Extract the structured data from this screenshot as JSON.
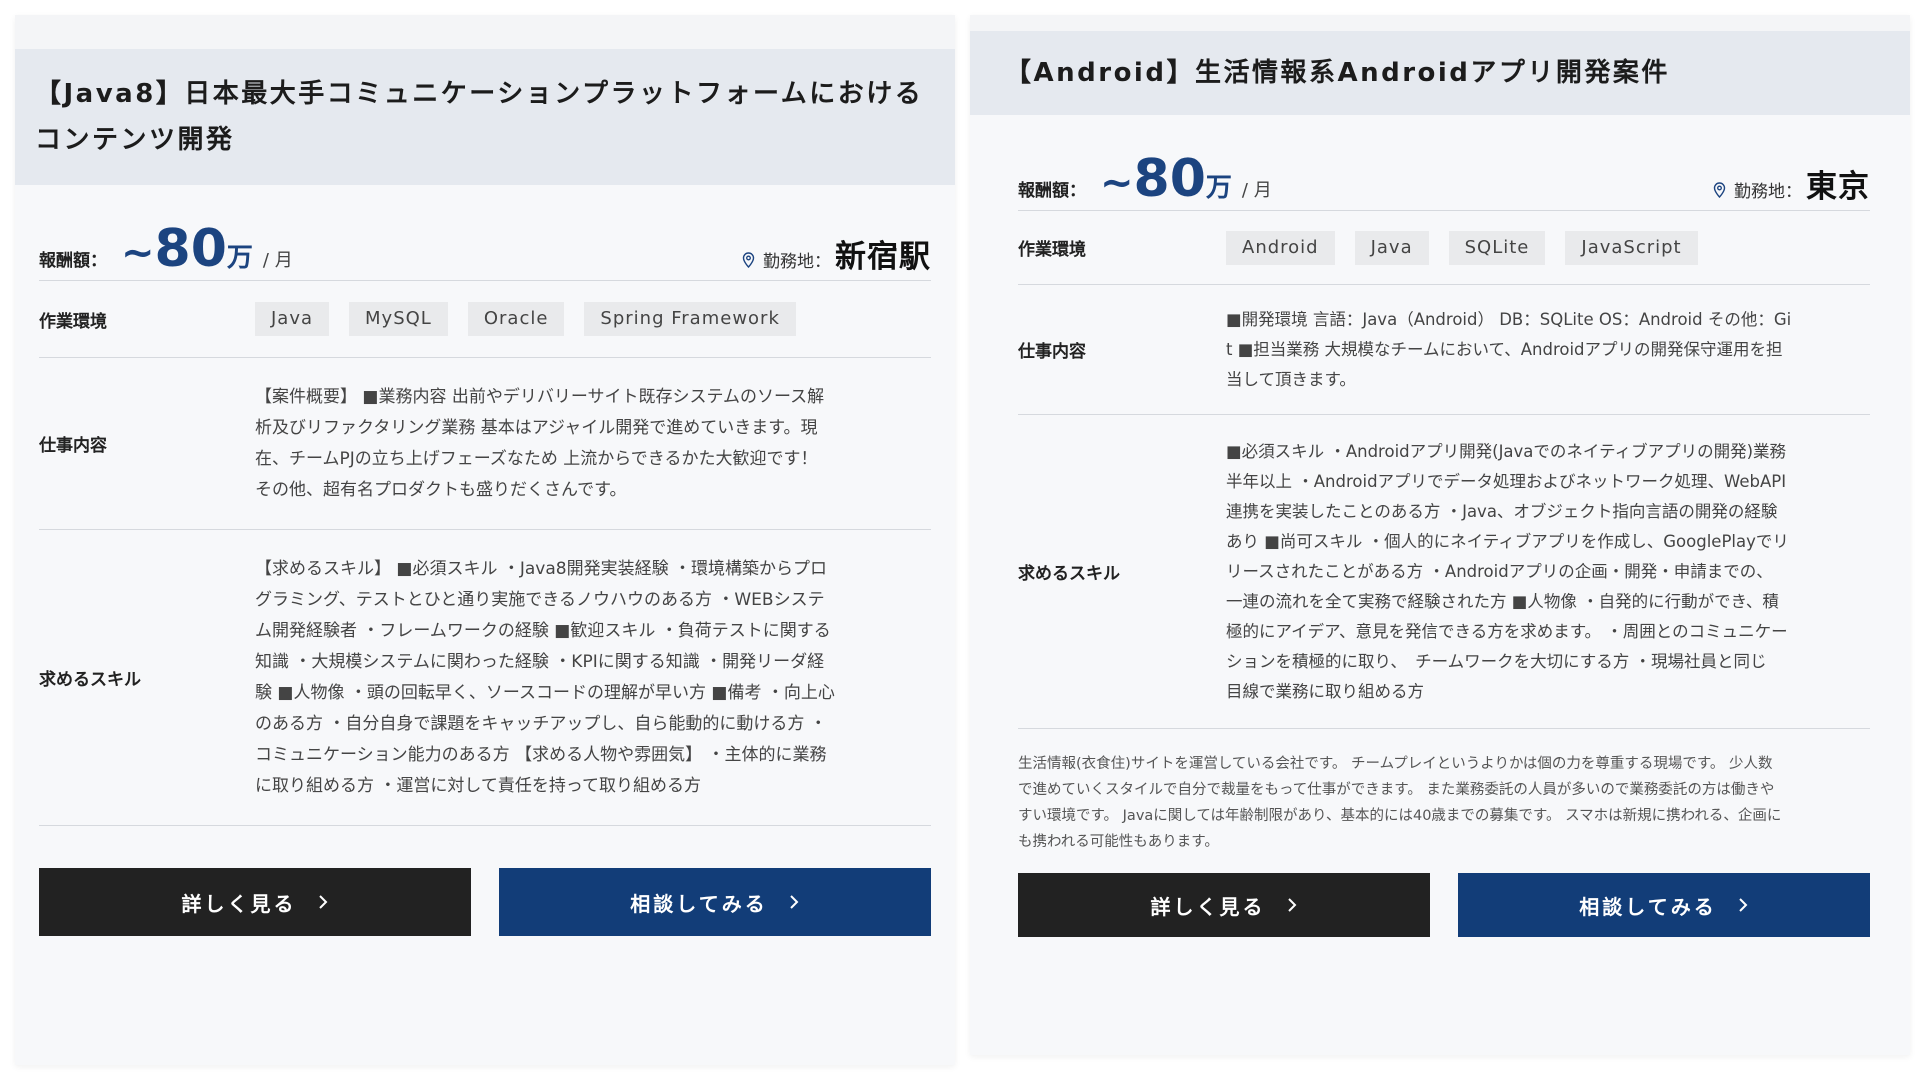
{
  "cards": [
    {
      "title_line1": "【Java8】日本最大手コミュニケーションプラットフォームにおける",
      "title_line2": "コンテンツ開発",
      "salary_label": "報酬額：",
      "salary_tilde": "~",
      "salary_value": "80",
      "salary_unit": "万",
      "salary_per": "/ 月",
      "location_label": "勤務地：",
      "location_value": "新宿駅",
      "env_label": "作業環境",
      "tags": [
        "Java",
        "MySQL",
        "Oracle",
        "Spring Framework"
      ],
      "job_label": "仕事内容",
      "job_lines": [
        "【案件概要】 ■業務内容 出前やデリバリーサイト既存システムのソース解",
        "析及びリファクタリング業務 基本はアジャイル開発で進めていきます。現",
        "在、チームPJの立ち上げフェーズなため 上流からできるかた大歓迎です！",
        "その他、超有名プロダクトも盛りだくさんです。"
      ],
      "skill_label": "求めるスキル",
      "skill_lines": [
        "【求めるスキル】 ■必須スキル ・Java8開発実装経験 ・環境構築からプロ",
        "グラミング、テストとひと通り実施できるノウハウのある方 ・WEBシステ",
        "ム開発経験者 ・フレームワークの経験 ■歓迎スキル ・負荷テストに関する",
        "知識 ・大規模システムに関わった経験 ・KPIに関する知識 ・開発リーダ経",
        "験 ■人物像 ・頭の回転早く、ソースコードの理解が早い方 ■備考 ・向上心",
        "のある方 ・自分自身で課題をキャッチアップし、自ら能動的に動ける方 ・",
        "コミュニケーション能力のある方 【求める人物や雰囲気】 ・主体的に業務",
        "に取り組める方 ・運営に対して責任を持って取り組める方"
      ],
      "btn_detail": "詳しく見る",
      "btn_consult": "相談してみる"
    },
    {
      "title_line1": "【Android】生活情報系Androidアプリ開発案件",
      "salary_label": "報酬額：",
      "salary_tilde": "~",
      "salary_value": "80",
      "salary_unit": "万",
      "salary_per": "/ 月",
      "location_label": "勤務地：",
      "location_value": "東京",
      "env_label": "作業環境",
      "tags": [
        "Android",
        "Java",
        "SQLite",
        "JavaScript"
      ],
      "job_label": "仕事内容",
      "job_lines": [
        "■開発環境 言語：Java（Android） DB：SQLite OS：Android その他：Gi",
        "t ■担当業務 大規模なチームにおいて、Androidアプリの開発保守運用を担",
        "当して頂きます。"
      ],
      "skill_label": "求めるスキル",
      "skill_lines": [
        "■必須スキル ・Androidアプリ開発(Javaでのネイティブアプリの開発)業務",
        "半年以上 ・Androidアプリでデータ処理およびネットワーク処理、WebAPI",
        "連携を実装したことのある方 ・Java、オブジェクト指向言語の開発の経験",
        "あり ■尚可スキル ・個人的にネイティブアプリを作成し、GooglePlayでリ",
        "リースされたことがある方 ・Androidアプリの企画・開発・申請までの、",
        "一連の流れを全て実務で経験された方 ■人物像 ・自発的に行動ができ、積",
        "極的にアイデア、意見を発信できる方を求めます。 ・周囲とのコミュニケー",
        "ションを積極的に取り、　チームワークを大切にする方 ・現場社員と同じ",
        "目線で業務に取り組める方"
      ],
      "note_lines": [
        "生活情報(衣食住)サイトを運営している会社です。 チームプレイというよりかは個の力を尊重する現場です。 少人数",
        "で進めていくスタイルで自分で裁量をもって仕事ができます。 また業務委託の人員が多いので業務委託の方は働きや",
        "すい環境です。 Javaに関しては年齢制限があり、基本的には40歳までの募集です。 スマホは新規に携われる、企画に",
        "も携われる可能性もあります。"
      ],
      "btn_detail": "詳しく見る",
      "btn_consult": "相談してみる"
    }
  ],
  "colors": {
    "accent_blue": "#1c4480",
    "button_blue": "#123d78",
    "button_dark": "#222222",
    "header_bg": "#e5e9ef"
  },
  "icons": {
    "location": "map-pin-icon",
    "chevron": "chevron-right-icon"
  }
}
